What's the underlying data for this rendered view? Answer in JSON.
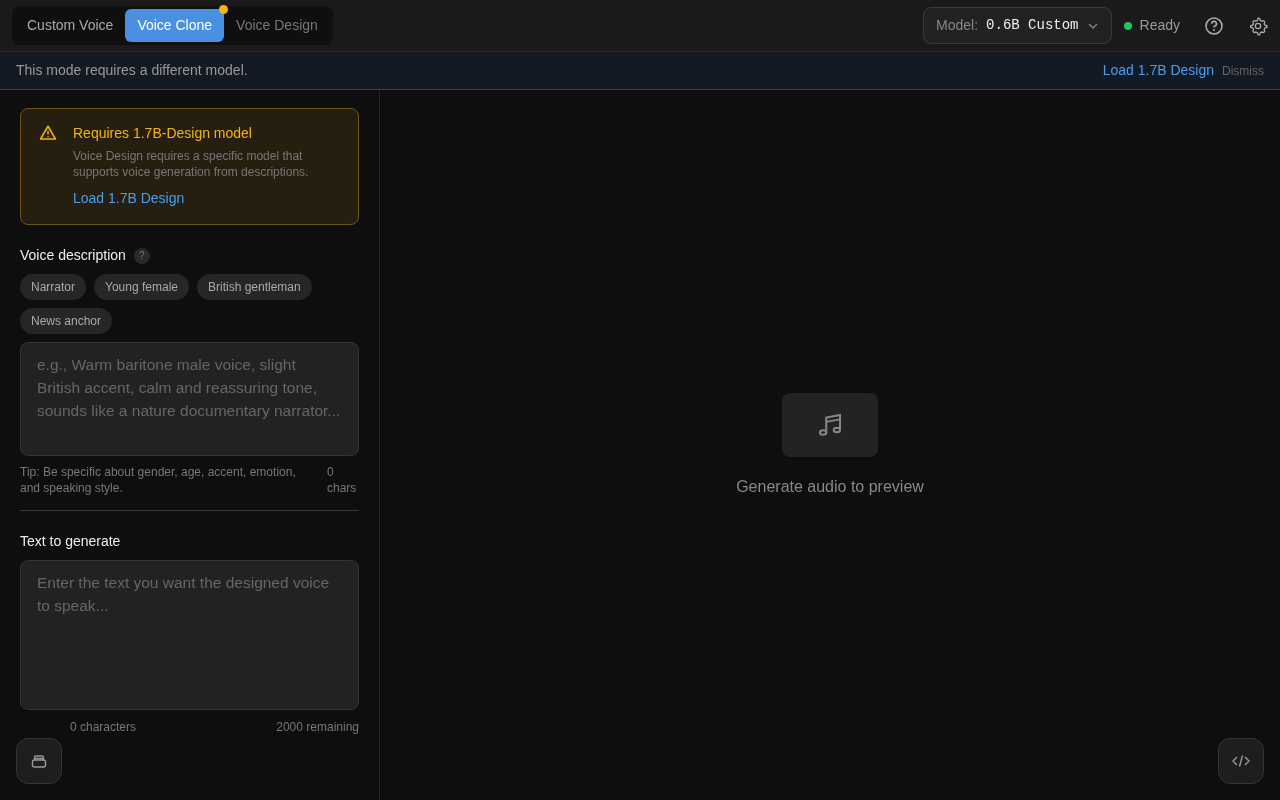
{
  "tabs": [
    {
      "label": "Custom Voice",
      "selected": false,
      "disabled": false,
      "notice": false
    },
    {
      "label": "Voice Clone",
      "selected": true,
      "disabled": false,
      "notice": true
    },
    {
      "label": "Voice Design",
      "selected": false,
      "disabled": true,
      "notice": false
    }
  ],
  "model_select": {
    "label": "Model:",
    "value": "0.6B Custom"
  },
  "status": {
    "label": "Ready",
    "kind": "ready"
  },
  "banner": {
    "message": "This mode requires a different model.",
    "action": "Load 1.7B Design",
    "dismiss": "Dismiss"
  },
  "warning": {
    "title": "Requires 1.7B-Design model",
    "body": "Voice Design requires a specific model that supports voice generation from descriptions.",
    "action": "Load 1.7B Design"
  },
  "voice_description": {
    "label": "Voice description",
    "help": "?",
    "presets": [
      "Narrator",
      "Young female",
      "British gentleman",
      "News anchor"
    ],
    "placeholder": "e.g., Warm baritone male voice, slight British accent, calm and reassuring tone, sounds like a nature documentary narrator...",
    "tip": "Tip: Be specific about gender, age, accent, emotion, and speaking style.",
    "count": "0 chars"
  },
  "text_to_generate": {
    "label": "Text to generate",
    "placeholder": "Enter the text you want the designed voice to speak...",
    "characters": "0 characters",
    "remaining": "2000 remaining"
  },
  "preview": {
    "message": "Generate audio to preview"
  }
}
